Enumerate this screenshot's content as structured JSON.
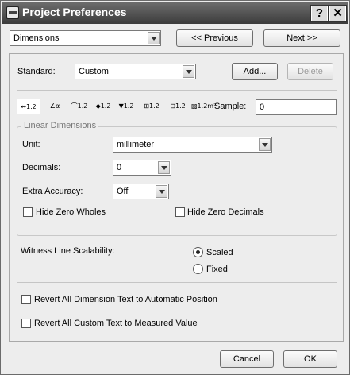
{
  "window": {
    "title": "Project Preferences",
    "help_glyph": "?",
    "close_glyph": "✕"
  },
  "nav": {
    "category": "Dimensions",
    "previous_label": "<< Previous",
    "next_label": "Next >>"
  },
  "standard": {
    "label": "Standard:",
    "value": "Custom",
    "add_label": "Add...",
    "delete_label": "Delete"
  },
  "tools": {
    "items": [
      {
        "name": "linear-dimension",
        "glyph": "↔1.2"
      },
      {
        "name": "angle-dimension",
        "glyph": "∠α"
      },
      {
        "name": "radial-dimension",
        "glyph": "⌒1.2"
      },
      {
        "name": "level-dimension",
        "glyph": "◆1.2"
      },
      {
        "name": "elevation-dimension",
        "glyph": "▼1.2"
      },
      {
        "name": "door-window-dimension",
        "glyph": "⊞1.2"
      },
      {
        "name": "sill-height-dimension",
        "glyph": "⊟1.2"
      },
      {
        "name": "area-dimension",
        "glyph": "▨1.2m²"
      }
    ],
    "sample_label": "Sample:",
    "sample_value": "0"
  },
  "linear": {
    "group_title": "Linear Dimensions",
    "unit_label": "Unit:",
    "unit_value": "millimeter",
    "decimals_label": "Decimals:",
    "decimals_value": "0",
    "extra_label": "Extra Accuracy:",
    "extra_value": "Off",
    "hide_wholes_label": "Hide Zero Wholes",
    "hide_decimals_label": "Hide Zero Decimals"
  },
  "witness": {
    "label": "Witness Line Scalability:",
    "scaled_label": "Scaled",
    "fixed_label": "Fixed",
    "selected": "Scaled"
  },
  "revert": {
    "dimension_text_label": "Revert All Dimension Text to Automatic Position",
    "custom_text_label": "Revert All Custom Text to Measured Value"
  },
  "footer": {
    "cancel_label": "Cancel",
    "ok_label": "OK"
  }
}
